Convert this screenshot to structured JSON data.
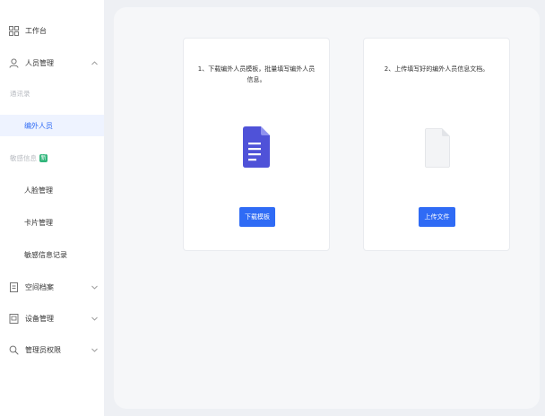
{
  "sidebar": {
    "items": [
      {
        "label": "工作台",
        "icon": "grid-icon"
      },
      {
        "label": "人员管理",
        "icon": "user-icon"
      },
      {
        "label": "通讯录"
      },
      {
        "label": "编外人员"
      },
      {
        "label": "敏感信息",
        "badge": "新"
      },
      {
        "label": "人脸管理"
      },
      {
        "label": "卡片管理"
      },
      {
        "label": "敏感信息记录"
      },
      {
        "label": "空间档案",
        "icon": "archive-icon"
      },
      {
        "label": "设备管理",
        "icon": "device-icon"
      },
      {
        "label": "管理员权限",
        "icon": "search-icon"
      }
    ]
  },
  "cards": {
    "download": {
      "instruction": "1、下载编外人员模板，批量填写编外人员信息。",
      "button": "下载模板",
      "icon": "doc-template-icon"
    },
    "upload": {
      "instruction": "2、上传填写好的编外人员信息文档。",
      "button": "上传文件",
      "icon": "file-blank-icon"
    }
  },
  "colors": {
    "accent": "#2f6bf5",
    "doc_icon": "#4f52d8",
    "badge": "#2fb57a"
  }
}
